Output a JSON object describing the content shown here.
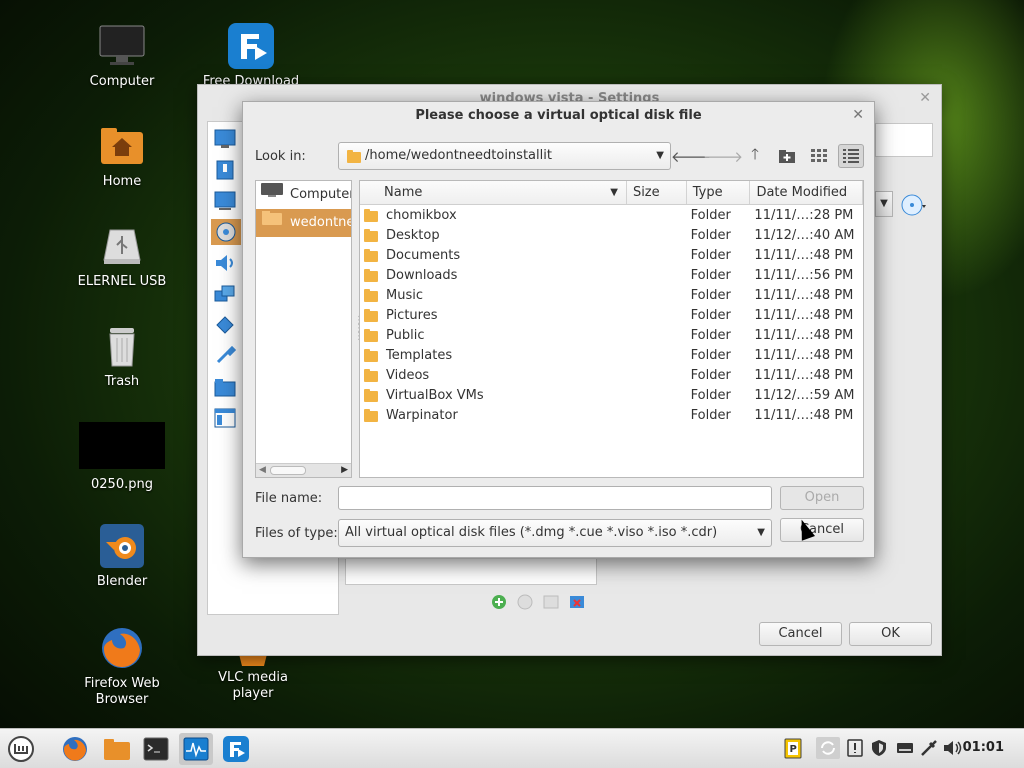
{
  "desktop": {
    "icons": [
      {
        "label": "Computer",
        "icon": "monitor-icon"
      },
      {
        "label": "Free Download",
        "icon": "free-download-manager-icon"
      },
      {
        "label": "Home",
        "icon": "home-folder-icon"
      },
      {
        "label": "ELERNEL USB",
        "icon": "usb-drive-icon"
      },
      {
        "label": "Trash",
        "icon": "trash-icon"
      },
      {
        "label": "0250.png",
        "icon": "image-thumbnail-icon"
      },
      {
        "label": "Blender",
        "icon": "blender-icon"
      },
      {
        "label": "Firefox Web Browser",
        "icon": "firefox-icon"
      },
      {
        "label": "VLC media player",
        "icon": "vlc-icon"
      }
    ]
  },
  "settings_window": {
    "title": "windows vista - Settings",
    "cancel_label": "Cancel",
    "ok_label": "OK"
  },
  "dialog": {
    "title": "Please choose a virtual optical disk file",
    "look_in_label": "Look in:",
    "look_in_value": "/home/wedontneedtoinstallit",
    "places": [
      {
        "label": "Computer",
        "selected": false
      },
      {
        "label": "wedontneedtoinstallit",
        "selected": true
      }
    ],
    "columns": [
      "Name",
      "Size",
      "Type",
      "Date Modified"
    ],
    "files": [
      {
        "name": "chomikbox",
        "size": "",
        "type": "Folder",
        "date": "11/11/…:28 PM"
      },
      {
        "name": "Desktop",
        "size": "",
        "type": "Folder",
        "date": "11/12/…:40 AM"
      },
      {
        "name": "Documents",
        "size": "",
        "type": "Folder",
        "date": "11/11/…:48 PM"
      },
      {
        "name": "Downloads",
        "size": "",
        "type": "Folder",
        "date": "11/11/…:56 PM"
      },
      {
        "name": "Music",
        "size": "",
        "type": "Folder",
        "date": "11/11/…:48 PM"
      },
      {
        "name": "Pictures",
        "size": "",
        "type": "Folder",
        "date": "11/11/…:48 PM"
      },
      {
        "name": "Public",
        "size": "",
        "type": "Folder",
        "date": "11/11/…:48 PM"
      },
      {
        "name": "Templates",
        "size": "",
        "type": "Folder",
        "date": "11/11/…:48 PM"
      },
      {
        "name": "Videos",
        "size": "",
        "type": "Folder",
        "date": "11/11/…:48 PM"
      },
      {
        "name": "VirtualBox VMs",
        "size": "",
        "type": "Folder",
        "date": "11/12/…:59 AM"
      },
      {
        "name": "Warpinator",
        "size": "",
        "type": "Folder",
        "date": "11/11/…:48 PM"
      }
    ],
    "file_name_label": "File name:",
    "file_name_value": "",
    "files_of_type_label": "Files of type:",
    "files_of_type_value": "All virtual optical disk files (*.dmg *.cue *.viso *.iso *.cdr)",
    "open_label": "Open",
    "cancel_label": "Cancel"
  },
  "taskbar": {
    "clock": "01:01"
  },
  "colors": {
    "selection": "#d99a50",
    "folder": "#f2b443"
  }
}
